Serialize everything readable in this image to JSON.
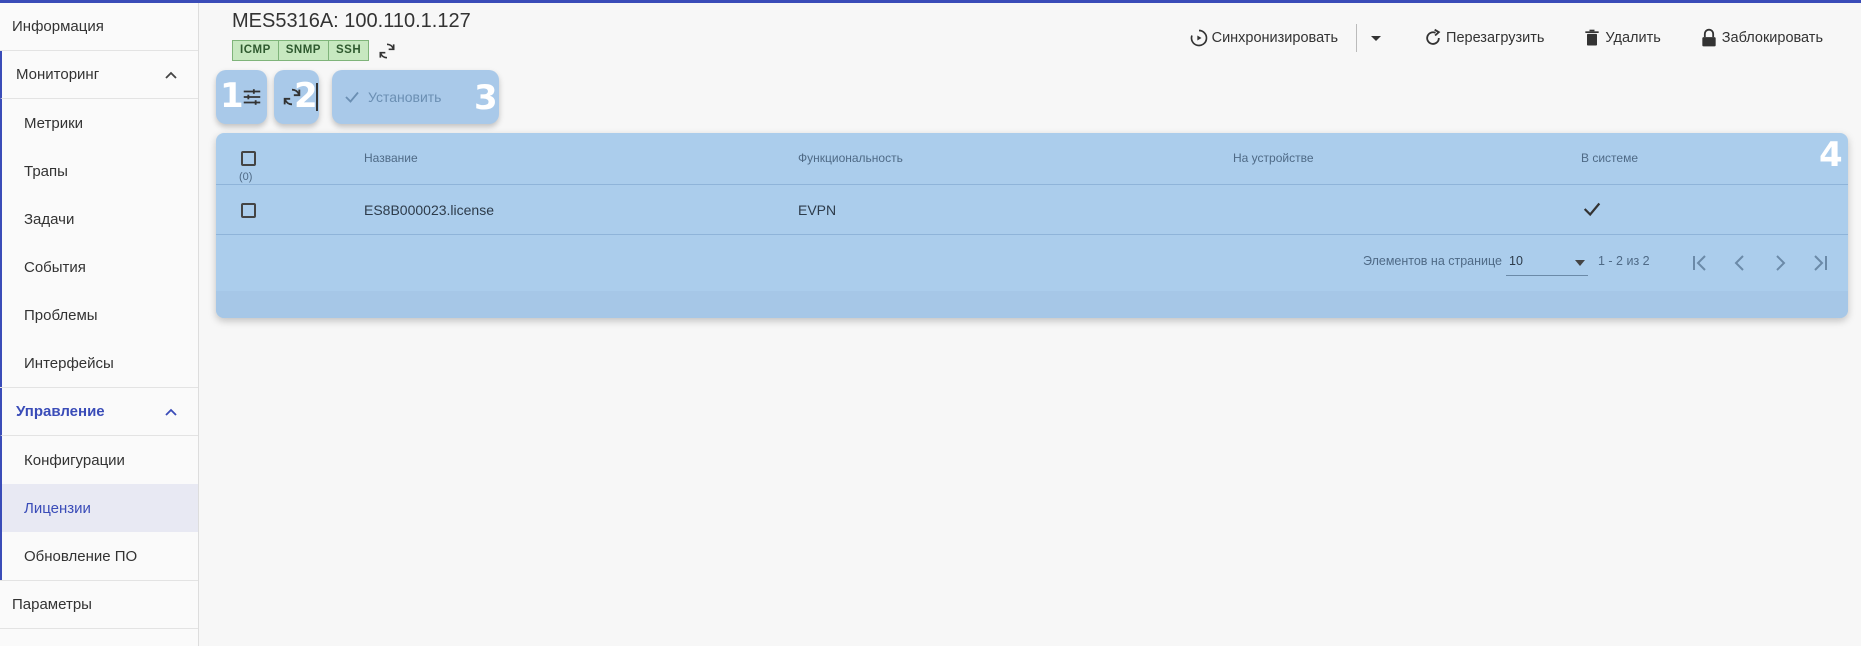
{
  "sidebar": {
    "info": "Информация",
    "monitoring": {
      "label": "Мониторинг",
      "items": [
        "Метрики",
        "Трапы",
        "Задачи",
        "События",
        "Проблемы",
        "Интерфейсы"
      ]
    },
    "management": {
      "label": "Управление",
      "items": [
        "Конфигурации",
        "Лицензии",
        "Обновление ПО"
      ],
      "selected": "Лицензии"
    },
    "params": "Параметры"
  },
  "header": {
    "title": "MES5316A: 100.110.1.127",
    "badges": [
      "ICMP",
      "SNMP",
      "SSH"
    ],
    "actions": {
      "sync": "Синхронизировать",
      "reboot": "Перезагрузить",
      "delete": "Удалить",
      "lock": "Заблокировать"
    }
  },
  "toolbar": {
    "marker_1": "1",
    "marker_2": "2",
    "marker_3": "3",
    "marker_4": "4",
    "install": "Установить"
  },
  "table": {
    "columns": [
      "Название",
      "Функциональность",
      "На устройстве",
      "В системе"
    ],
    "selected_count": "(0)",
    "rows": [
      {
        "name": "ES8B000023.license",
        "function": "EVPN",
        "on_device": "",
        "in_system": "check-icon"
      }
    ]
  },
  "pagination": {
    "per_page_label": "Элементов на странице",
    "per_page_value": "10",
    "range": "1 - 2 из 2"
  },
  "colors": {
    "accent": "#3a4cb8",
    "overlay": "#abcdec",
    "badge_bg": "#c7e8c0"
  }
}
